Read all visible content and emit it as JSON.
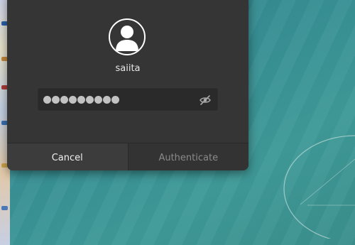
{
  "dialog": {
    "username": "saiita",
    "password": {
      "masked_length": 9,
      "reveal_icon": "eye-slash-icon"
    },
    "avatar_icon": "user-avatar-icon",
    "buttons": {
      "cancel": "Cancel",
      "authenticate": "Authenticate"
    }
  },
  "colors": {
    "dialog_bg": "#353535",
    "desktop_teal": "#378f94",
    "text_primary": "#e8e8e8",
    "text_disabled": "#8a8a8a"
  }
}
